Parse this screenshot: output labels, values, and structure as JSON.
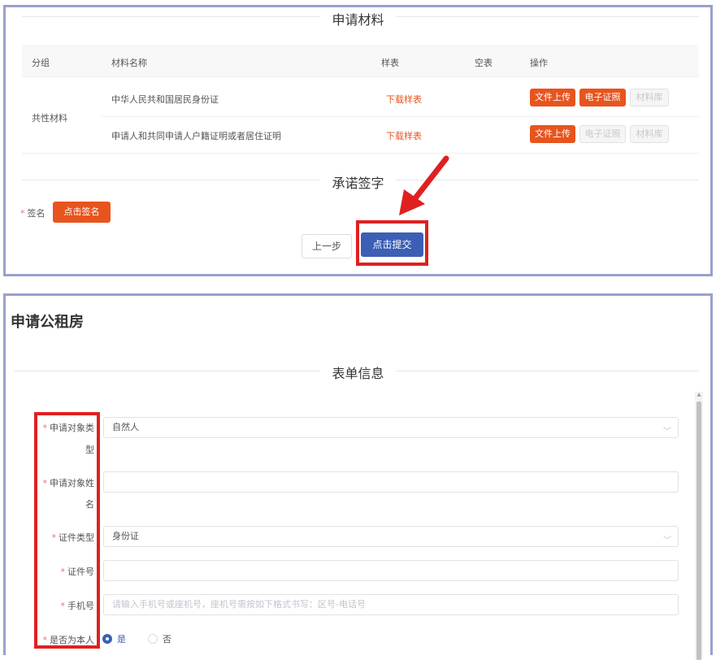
{
  "materials": {
    "title": "申请材料",
    "headers": [
      "分组",
      "材料名称",
      "样表",
      "空表",
      "操作"
    ],
    "group": "共性材料",
    "rows": [
      {
        "name": "中华人民共和国居民身份证",
        "sample": "下载样表",
        "actions": [
          "文件上传",
          "电子证照",
          "材料库"
        ]
      },
      {
        "name": "申请人和共同申请人户籍证明或者居住证明",
        "sample": "下载样表",
        "actions": [
          "文件上传",
          "电子证照",
          "材料库"
        ]
      }
    ]
  },
  "commitment": {
    "title": "承诺签字",
    "sign_label": "签名",
    "sign_button": "点击签名",
    "prev_button": "上一步",
    "submit_button": "点击提交"
  },
  "form": {
    "page_title": "申请公租房",
    "section_title": "表单信息",
    "fields": [
      {
        "label_1": "申请对象类",
        "label_2": "型",
        "value": "自然人"
      },
      {
        "label_1": "申请对象姓",
        "label_2": "名",
        "value": ""
      },
      {
        "label": "证件类型",
        "value": "身份证"
      },
      {
        "label": "证件号",
        "value": ""
      },
      {
        "label": "手机号",
        "placeholder": "请输入手机号或座机号，座机号需按如下格式书写：区号-电话号"
      },
      {
        "label": "是否为本人",
        "options": [
          "是",
          "否"
        ],
        "selected": "是"
      }
    ]
  },
  "colors": {
    "accent": "#e8541e",
    "primary": "#3c5fb5",
    "highlight": "#e02020",
    "frame": "#9aa0cc"
  }
}
